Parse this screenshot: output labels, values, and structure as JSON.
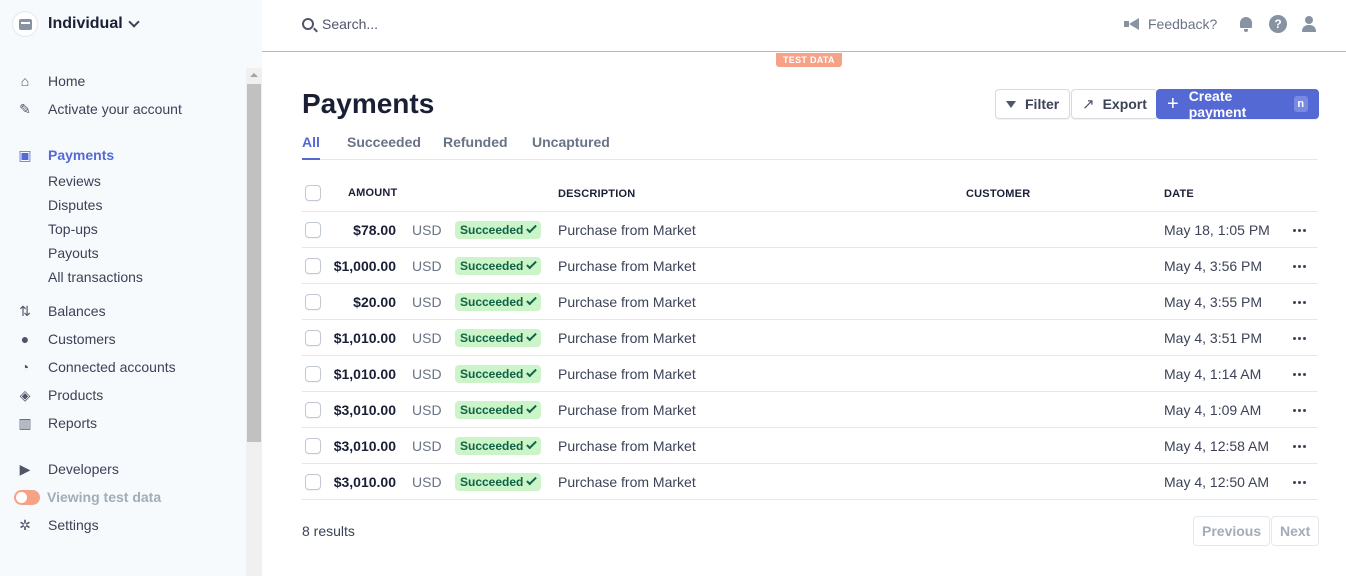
{
  "account": {
    "name": "Individual"
  },
  "sidebar": {
    "home": "Home",
    "activate": "Activate your account",
    "payments": "Payments",
    "payments_sub": [
      "Reviews",
      "Disputes",
      "Top-ups",
      "Payouts",
      "All transactions"
    ],
    "balances": "Balances",
    "customers": "Customers",
    "connected": "Connected accounts",
    "products": "Products",
    "reports": "Reports",
    "developers": "Developers",
    "test_data": "Viewing test data",
    "settings": "Settings"
  },
  "topbar": {
    "search_placeholder": "Search...",
    "feedback": "Feedback?",
    "help": "?",
    "test_badge": "TEST DATA"
  },
  "page": {
    "title": "Payments",
    "filter": "Filter",
    "export": "Export",
    "create": "Create payment",
    "create_shortcut": "n",
    "tabs": [
      "All",
      "Succeeded",
      "Refunded",
      "Uncaptured"
    ]
  },
  "table": {
    "headers": {
      "amount": "AMOUNT",
      "description": "DESCRIPTION",
      "customer": "CUSTOMER",
      "date": "DATE"
    },
    "rows": [
      {
        "amount": "$78.00",
        "currency": "USD",
        "status": "Succeeded",
        "description": "Purchase from Market",
        "customer": "",
        "date": "May 18, 1:05 PM"
      },
      {
        "amount": "$1,000.00",
        "currency": "USD",
        "status": "Succeeded",
        "description": "Purchase from Market",
        "customer": "",
        "date": "May 4, 3:56 PM"
      },
      {
        "amount": "$20.00",
        "currency": "USD",
        "status": "Succeeded",
        "description": "Purchase from Market",
        "customer": "",
        "date": "May 4, 3:55 PM"
      },
      {
        "amount": "$1,010.00",
        "currency": "USD",
        "status": "Succeeded",
        "description": "Purchase from Market",
        "customer": "",
        "date": "May 4, 3:51 PM"
      },
      {
        "amount": "$1,010.00",
        "currency": "USD",
        "status": "Succeeded",
        "description": "Purchase from Market",
        "customer": "",
        "date": "May 4, 1:14 AM"
      },
      {
        "amount": "$3,010.00",
        "currency": "USD",
        "status": "Succeeded",
        "description": "Purchase from Market",
        "customer": "",
        "date": "May 4, 1:09 AM"
      },
      {
        "amount": "$3,010.00",
        "currency": "USD",
        "status": "Succeeded",
        "description": "Purchase from Market",
        "customer": "",
        "date": "May 4, 12:58 AM"
      },
      {
        "amount": "$3,010.00",
        "currency": "USD",
        "status": "Succeeded",
        "description": "Purchase from Market",
        "customer": "",
        "date": "May 4, 12:50 AM"
      }
    ]
  },
  "footer": {
    "results": "8 results",
    "previous": "Previous",
    "next": "Next"
  },
  "colors": {
    "accent": "#5469d4",
    "test_mode": "#f5a287",
    "success_bg": "#cbf4c9",
    "success_fg": "#0e6245"
  }
}
